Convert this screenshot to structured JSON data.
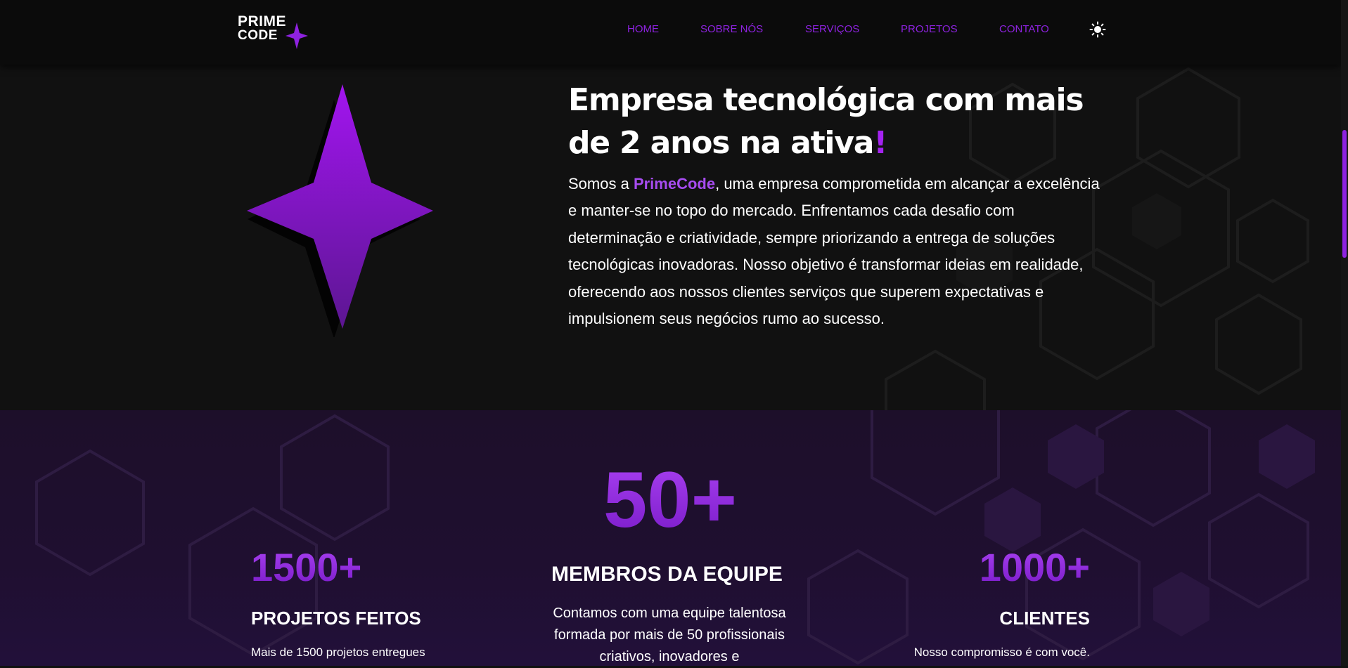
{
  "brand": {
    "line1": "PRIME",
    "line2": "CODE",
    "accent_color": "#8e22e0"
  },
  "nav": {
    "items": [
      {
        "label": "HOME"
      },
      {
        "label": "SOBRE NÓS"
      },
      {
        "label": "SERVIÇOS"
      },
      {
        "label": "PROJETOS"
      },
      {
        "label": "CONTATO"
      }
    ]
  },
  "theme_toggle": {
    "icon": "sun-icon"
  },
  "hero": {
    "title": "Empresa tecnológica com mais de 2 anos na ativa",
    "title_mark": "!",
    "desc_before": "Somos a ",
    "desc_brand": "PrimeCode",
    "desc_after": ", uma empresa comprometida em alcançar a excelência e manter-se no topo do mercado. Enfrentamos cada desafio com determinação e criatividade, sempre priorizando a entrega de soluções tecnológicas inovadoras. Nosso objetivo é transformar ideias em realidade, oferecendo aos nossos clientes serviços que superem expectativas e impulsionem seus negócios rumo ao sucesso."
  },
  "stats": [
    {
      "number": "1500+",
      "title": "PROJETOS FEITOS",
      "description": "Mais de 1500 projetos entregues"
    },
    {
      "number": "50+",
      "title": "MEMBROS DA EQUIPE",
      "description": "Contamos com uma equipe talentosa formada por mais de 50 profissionais criativos, inovadores e"
    },
    {
      "number": "1000+",
      "title": "CLIENTES",
      "description": "Nosso compromisso é com você."
    }
  ]
}
